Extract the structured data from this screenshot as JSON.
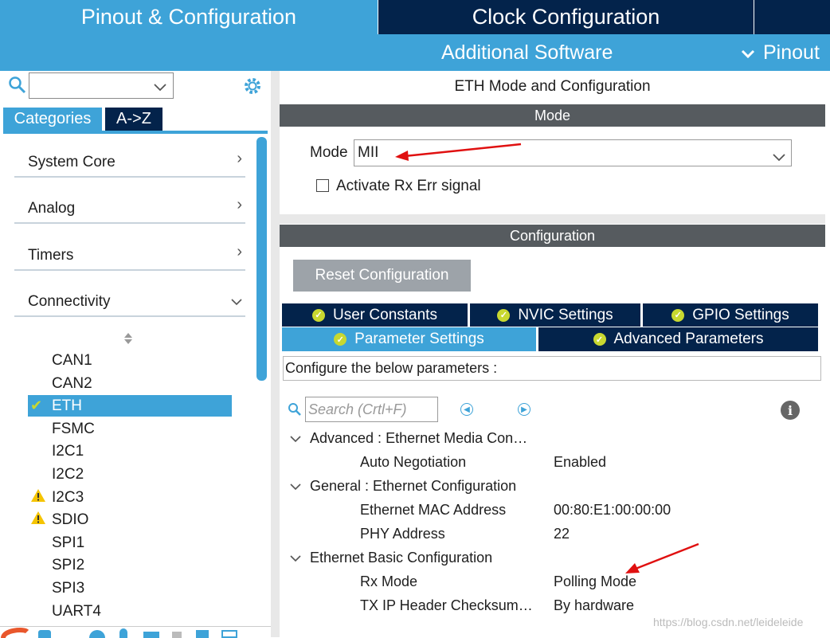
{
  "top_tabs": {
    "pinout": "Pinout & Configuration",
    "clock": "Clock Configuration"
  },
  "sub_bar": {
    "additional_software": "Additional Software",
    "pinout_dropdown": "Pinout"
  },
  "left_panel": {
    "search": {
      "value": ""
    },
    "tabs": {
      "categories": "Categories",
      "az": "A->Z"
    },
    "categories": [
      "System Core",
      "Analog",
      "Timers",
      "Connectivity"
    ],
    "peripherals": [
      {
        "label": "CAN1",
        "status": ""
      },
      {
        "label": "CAN2",
        "status": ""
      },
      {
        "label": "ETH",
        "status": "ok",
        "selected": true
      },
      {
        "label": "FSMC",
        "status": ""
      },
      {
        "label": "I2C1",
        "status": ""
      },
      {
        "label": "I2C2",
        "status": ""
      },
      {
        "label": "I2C3",
        "status": "warning"
      },
      {
        "label": "SDIO",
        "status": "warning"
      },
      {
        "label": "SPI1",
        "status": ""
      },
      {
        "label": "SPI2",
        "status": ""
      },
      {
        "label": "SPI3",
        "status": ""
      },
      {
        "label": "UART4",
        "status": ""
      }
    ]
  },
  "right_panel": {
    "title": "ETH Mode and Configuration",
    "mode_header": "Mode",
    "mode_label": "Mode",
    "mode_value": "MII",
    "rx_err_label": "Activate Rx Err signal",
    "config_header": "Configuration",
    "reset_button": "Reset Configuration",
    "config_tabs": [
      "User Constants",
      "NVIC Settings",
      "GPIO Settings",
      "Parameter Settings",
      "Advanced Parameters"
    ],
    "configure_text": "Configure the below parameters :",
    "search_placeholder": "Search (Crtl+F)",
    "groups": [
      {
        "title": "Advanced : Ethernet Media Con…",
        "params": [
          {
            "name": "Auto Negotiation",
            "value": "Enabled"
          }
        ]
      },
      {
        "title": "General : Ethernet Configuration",
        "params": [
          {
            "name": "Ethernet MAC Address",
            "value": "00:80:E1:00:00:00"
          },
          {
            "name": "PHY Address",
            "value": "22"
          }
        ]
      },
      {
        "title": "Ethernet Basic Configuration",
        "params": [
          {
            "name": "Rx Mode",
            "value": "Polling Mode"
          },
          {
            "name": "TX IP Header Checksum…",
            "value": "By hardware"
          }
        ]
      }
    ]
  },
  "watermark": "https://blog.csdn.net/leideleide",
  "colors": {
    "accent": "#3ea3d8",
    "dark": "#03234b",
    "header_gray": "#565b5f",
    "ok": "#c8d830",
    "warning": "#f5c400",
    "annotation": "#e01010"
  }
}
